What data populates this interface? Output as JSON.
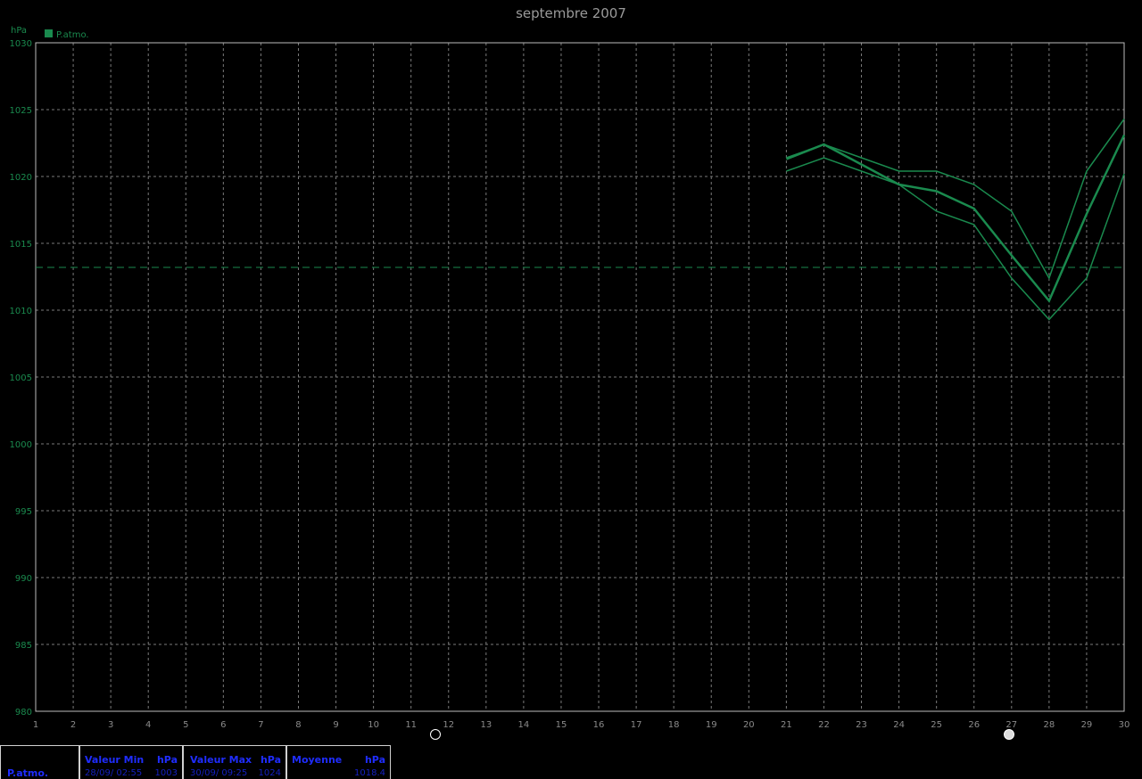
{
  "chart_data": {
    "type": "line",
    "title": "septembre 2007",
    "ylabel": "hPa",
    "legend": [
      "P.atmo."
    ],
    "x_ticks": [
      1,
      2,
      3,
      4,
      5,
      6,
      7,
      8,
      9,
      10,
      11,
      12,
      13,
      14,
      15,
      16,
      17,
      18,
      19,
      20,
      21,
      22,
      23,
      24,
      25,
      26,
      27,
      28,
      29,
      30
    ],
    "xlim": [
      1,
      30
    ],
    "ylim": [
      980,
      1030
    ],
    "y_ticks": [
      980,
      985,
      990,
      995,
      1000,
      1005,
      1010,
      1015,
      1020,
      1025,
      1030
    ],
    "grid": true,
    "series": [
      {
        "role": "max",
        "x": [
          21,
          22,
          23,
          24,
          25,
          26,
          27,
          28,
          29,
          30
        ],
        "values": [
          1021.4,
          1022.4,
          1021.4,
          1020.4,
          1020.4,
          1019.4,
          1017.4,
          1012.4,
          1020.4,
          1024.3
        ]
      },
      {
        "role": "mean",
        "x": [
          21,
          22,
          23,
          24,
          25,
          26,
          27,
          28,
          29,
          30
        ],
        "values": [
          1021.3,
          1022.4,
          1020.9,
          1019.4,
          1018.9,
          1017.6,
          1014.1,
          1010.7,
          1017.2,
          1023.1
        ]
      },
      {
        "role": "min",
        "x": [
          21,
          22,
          23,
          24,
          25,
          26,
          27,
          28,
          29,
          30
        ],
        "values": [
          1020.4,
          1021.4,
          1020.4,
          1019.4,
          1017.4,
          1016.4,
          1012.4,
          1009.3,
          1012.4,
          1020.2
        ]
      }
    ],
    "mean_line": 1013.2,
    "colors": {
      "series": "#1a8a4e",
      "grid": "#7a7a7a",
      "axis": "#1a8a4e",
      "title": "#9a9a9a"
    }
  },
  "stats": {
    "label": "P.atmo.",
    "min": {
      "header": "Valeur Min",
      "unit": "hPa",
      "date": "28/09/  02:55",
      "value": "1003"
    },
    "max": {
      "header": "Valeur Max",
      "unit": "hPa",
      "date": "30/09/  09:25",
      "value": "1024"
    },
    "mean": {
      "header": "Moyenne",
      "unit": "hPa",
      "value": "1018.4"
    }
  },
  "icons": {
    "new_moon": "new-moon-icon",
    "full_moon": "full-moon-icon"
  }
}
